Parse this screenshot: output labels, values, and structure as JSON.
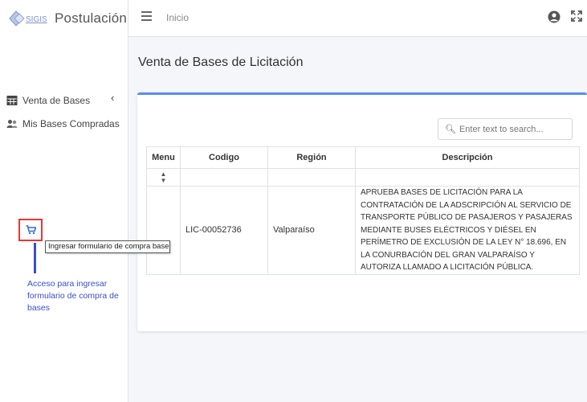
{
  "brand": {
    "logo_text": "SIGIS",
    "app_name": "Postulación"
  },
  "topbar": {
    "breadcrumb": "Inicio",
    "icons": [
      "menu-icon",
      "user-icon",
      "expand-icon"
    ]
  },
  "sidebar": {
    "items": [
      {
        "label": "Venta de Bases",
        "icon": "table-icon"
      },
      {
        "label": "Mis Bases Compradas",
        "icon": "users-icon"
      }
    ]
  },
  "main": {
    "title": "Venta de Bases de Licitación",
    "search": {
      "placeholder": "Enter text to search..."
    },
    "table": {
      "columns": [
        "Menu",
        "Codigo",
        "Región",
        "Descripción"
      ],
      "rows": [
        {
          "codigo": "LIC-00052736",
          "region": "Valparaíso",
          "descripcion": "APRUEBA BASES DE LICITACIÓN PARA LA CONTRATACIÓN DE LA ADSCRIPCIÓN AL SERVICIO DE TRANSPORTE PÚBLICO DE PASAJEROS Y PASAJERAS MEDIANTE BUSES ELÉCTRICOS Y DIÉSEL EN PERÍMETRO DE EXCLUSIÓN DE LA LEY N° 18.696, EN LA CONURBACIÓN DEL GRAN VALPARAÍSO Y AUTORIZA LLAMADO A LICITACIÓN PÚBLICA."
        }
      ]
    },
    "tooltip": "Ingresar formulario de compra base",
    "annotation": "Acceso para ingresar formulario de compra de bases"
  },
  "colors": {
    "accent": "#5a8dee",
    "highlight": "#e53935",
    "annotation": "#3b4ec8"
  }
}
